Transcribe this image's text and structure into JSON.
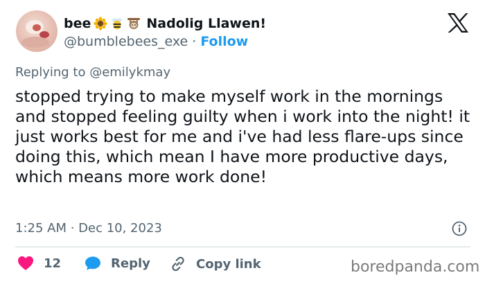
{
  "tweet": {
    "display_name": "bee",
    "name_emojis": [
      "sunflower-emoji",
      "bee-emoji",
      "sloth-emoji"
    ],
    "display_name_rest": "Nadolig Llawen!",
    "handle": "@bumblebees_exe",
    "separator": "·",
    "follow_label": "Follow",
    "reply_context": "Replying to @emilykmay",
    "text": "stopped trying to make myself work in the mornings and stopped feeling guilty when i work into the night! it just works best for me and i've had less flare-ups since doing this, which mean I have more productive days, which means more work done!",
    "timestamp": "1:25 AM · Dec 10, 2023"
  },
  "actions": {
    "like_count": "12",
    "reply_label": "Reply",
    "copy_link_label": "Copy link"
  },
  "watermark": "boredpanda.com",
  "colors": {
    "accent": "#1d9bf0",
    "like": "#f91880",
    "secondary_text": "#536471",
    "divider": "#cfd9de"
  },
  "icons": {
    "brand": "x-logo-icon",
    "info": "info-icon",
    "like": "heart-icon",
    "reply": "speech-bubble-icon",
    "copy_link": "link-icon"
  }
}
